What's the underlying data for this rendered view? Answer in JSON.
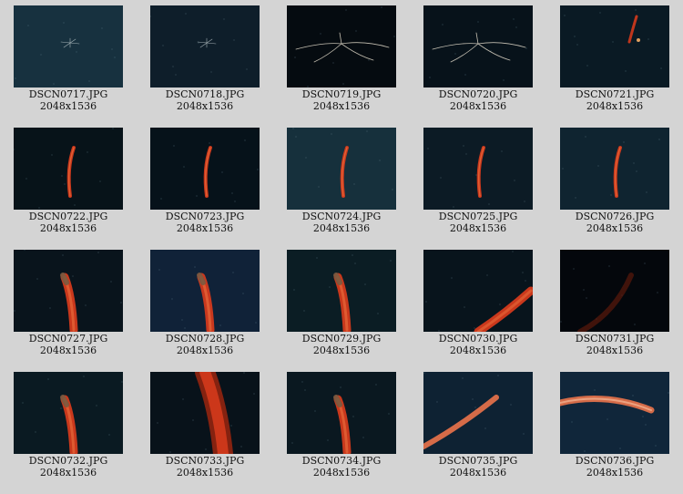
{
  "thumbnails": [
    {
      "name": "DSCN0717.JPG",
      "dims": "2048x1536",
      "bg": "#17313f",
      "subject": "siphonophore-faint"
    },
    {
      "name": "DSCN0718.JPG",
      "dims": "2048x1536",
      "bg": "#0e1e2a",
      "subject": "siphonophore-faint"
    },
    {
      "name": "DSCN0719.JPG",
      "dims": "2048x1536",
      "bg": "#050b10",
      "subject": "siphonophore-legs"
    },
    {
      "name": "DSCN0720.JPG",
      "dims": "2048x1536",
      "bg": "#07121a",
      "subject": "siphonophore-legs"
    },
    {
      "name": "DSCN0721.JPG",
      "dims": "2048x1536",
      "bg": "#0a1a24",
      "subject": "siphonophore-small"
    },
    {
      "name": "DSCN0722.JPG",
      "dims": "2048x1536",
      "bg": "#071319",
      "subject": "siphonophore-red"
    },
    {
      "name": "DSCN0723.JPG",
      "dims": "2048x1536",
      "bg": "#06121a",
      "subject": "siphonophore-red"
    },
    {
      "name": "DSCN0724.JPG",
      "dims": "2048x1536",
      "bg": "#16303c",
      "subject": "siphonophore-red"
    },
    {
      "name": "DSCN0725.JPG",
      "dims": "2048x1536",
      "bg": "#0c1b25",
      "subject": "siphonophore-red"
    },
    {
      "name": "DSCN0726.JPG",
      "dims": "2048x1536",
      "bg": "#0f2430",
      "subject": "siphonophore-red"
    },
    {
      "name": "DSCN0727.JPG",
      "dims": "2048x1536",
      "bg": "#09141c",
      "subject": "siphonophore-close"
    },
    {
      "name": "DSCN0728.JPG",
      "dims": "2048x1536",
      "bg": "#102238",
      "subject": "siphonophore-close"
    },
    {
      "name": "DSCN0729.JPG",
      "dims": "2048x1536",
      "bg": "#0b1d24",
      "subject": "siphonophore-close"
    },
    {
      "name": "DSCN0730.JPG",
      "dims": "2048x1536",
      "bg": "#08141c",
      "subject": "siphonophore-diagonal"
    },
    {
      "name": "DSCN0731.JPG",
      "dims": "2048x1536",
      "bg": "#04070c",
      "subject": "siphonophore-dark"
    },
    {
      "name": "DSCN0732.JPG",
      "dims": "2048x1536",
      "bg": "#0a1a22",
      "subject": "siphonophore-close"
    },
    {
      "name": "DSCN0733.JPG",
      "dims": "2048x1536",
      "bg": "#08121a",
      "subject": "siphonophore-bulk"
    },
    {
      "name": "DSCN0734.JPG",
      "dims": "2048x1536",
      "bg": "#0a1820",
      "subject": "siphonophore-close"
    },
    {
      "name": "DSCN0735.JPG",
      "dims": "2048x1536",
      "bg": "#0e2233",
      "subject": "siphonophore-diagonal-long"
    },
    {
      "name": "DSCN0736.JPG",
      "dims": "2048x1536",
      "bg": "#10263a",
      "subject": "siphonophore-horizontal"
    }
  ]
}
